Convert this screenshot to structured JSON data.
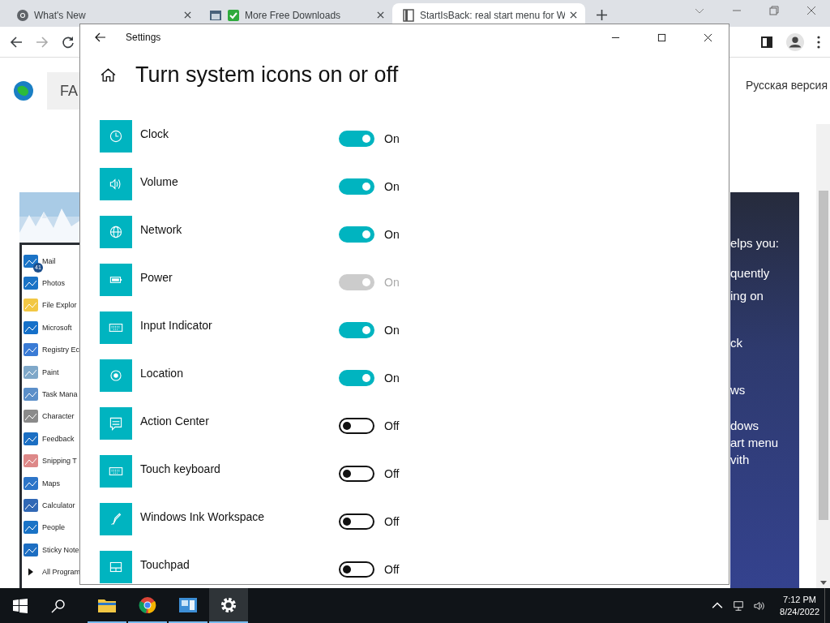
{
  "browser": {
    "tabs": [
      {
        "title": "What's New",
        "selected": false
      },
      {
        "title": "More Free Downloads",
        "selected": false
      },
      {
        "title": "StartIsBack: real start menu for W",
        "selected": true
      }
    ],
    "page": {
      "faq_tab": "FA",
      "language_link": "Русская версия",
      "start_menu": {
        "mail_badge": "41",
        "items": [
          "Mail",
          "Photos",
          "File Explor",
          "Microsoft",
          "Registry Ec",
          "Paint",
          "Task Mana",
          "Character",
          "Feedback",
          "Snipping T",
          "Maps",
          "Calculator",
          "People",
          "Sticky Note",
          "All Program"
        ]
      },
      "banner_lines": [
        "elps you:",
        "quently",
        "ing on",
        "ck",
        "ws",
        "dows",
        "art menu",
        "vith"
      ]
    }
  },
  "settings": {
    "title": "Settings",
    "heading": "Turn system icons on or off",
    "items": [
      {
        "name": "Clock",
        "on": true,
        "disabled": false,
        "state": "On"
      },
      {
        "name": "Volume",
        "on": true,
        "disabled": false,
        "state": "On"
      },
      {
        "name": "Network",
        "on": true,
        "disabled": false,
        "state": "On"
      },
      {
        "name": "Power",
        "on": true,
        "disabled": true,
        "state": "On"
      },
      {
        "name": "Input Indicator",
        "on": true,
        "disabled": false,
        "state": "On"
      },
      {
        "name": "Location",
        "on": true,
        "disabled": false,
        "state": "On"
      },
      {
        "name": "Action Center",
        "on": false,
        "disabled": false,
        "state": "Off"
      },
      {
        "name": "Touch keyboard",
        "on": false,
        "disabled": false,
        "state": "Off"
      },
      {
        "name": "Windows Ink Workspace",
        "on": false,
        "disabled": false,
        "state": "Off"
      },
      {
        "name": "Touchpad",
        "on": false,
        "disabled": false,
        "state": "Off"
      }
    ]
  },
  "taskbar": {
    "time": "7:12 PM",
    "date": "8/24/2022"
  }
}
